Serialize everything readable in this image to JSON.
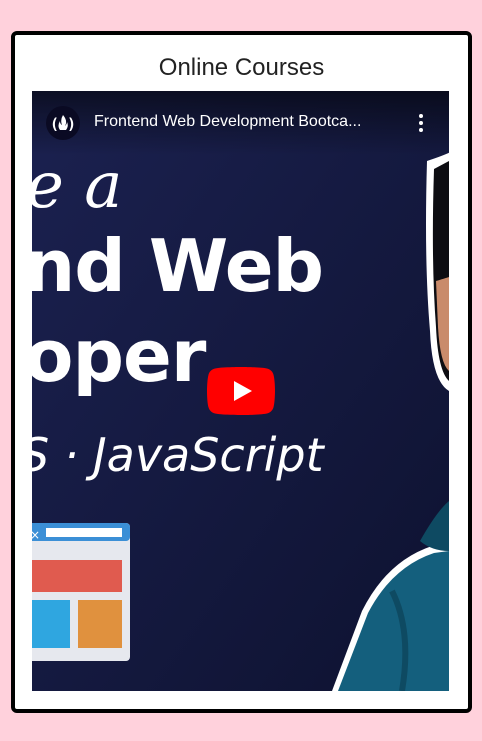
{
  "card": {
    "title": "Online Courses"
  },
  "video": {
    "title": "Frontend Web Development Bootca...",
    "channel_icon": "freecodecamp-logo-icon",
    "menu_icon": "more-vert-icon",
    "play_icon": "youtube-play-icon",
    "thumbnail": {
      "line1": "e a",
      "line2": "nd Web",
      "line3": "oper",
      "line4": "S · JavaScript"
    },
    "colors": {
      "background": "#13193d",
      "play_red": "#ff0000",
      "hoodie": "#145f7d"
    }
  },
  "colors": {
    "page_background": "#ffd1dc",
    "card_border": "#000000"
  }
}
